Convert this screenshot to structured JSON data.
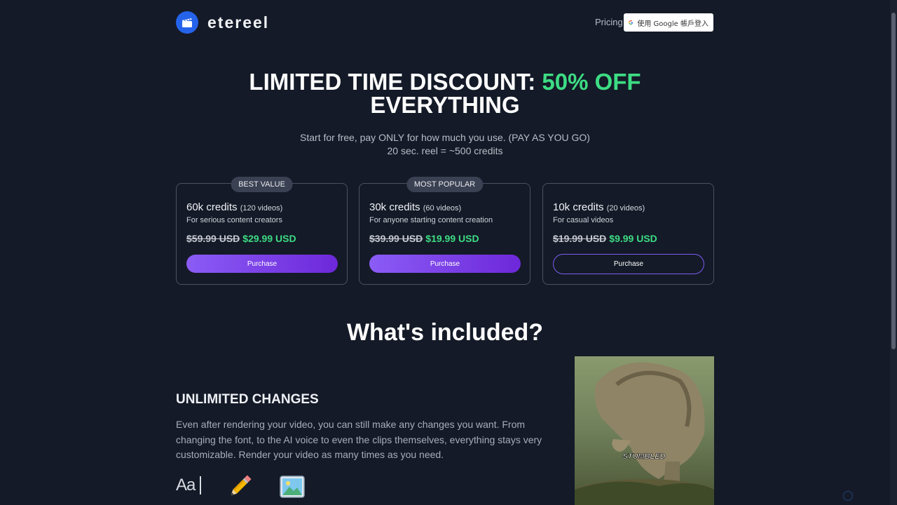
{
  "header": {
    "brand": "etereel",
    "nav_pricing": "Pricing",
    "google_signin": "使用 Google 帳戶登入"
  },
  "hero": {
    "title_part1": "LIMITED TIME DISCOUNT: ",
    "title_accent": "50% OFF",
    "title_part2": "EVERYTHING",
    "subtitle_line1": "Start for free, pay ONLY for how much you use. (PAY AS YOU GO)",
    "subtitle_line2": "20 sec. reel = ~500 credits"
  },
  "plans": [
    {
      "badge": "BEST VALUE",
      "credits": "60k credits",
      "videos": "(120 videos)",
      "desc": "For serious content creators",
      "old_price": "$59.99 USD",
      "new_price": "$29.99 USD",
      "button": "Purchase"
    },
    {
      "badge": "MOST POPULAR",
      "credits": "30k credits",
      "videos": "(60 videos)",
      "desc": "For anyone starting content creation",
      "old_price": "$39.99 USD",
      "new_price": "$19.99 USD",
      "button": "Purchase"
    },
    {
      "badge": "",
      "credits": "10k credits",
      "videos": "(20 videos)",
      "desc": "For casual videos",
      "old_price": "$19.99 USD",
      "new_price": "$9.99 USD",
      "button": "Purchase"
    }
  ],
  "included": {
    "section_title": "What's included?",
    "feature_title": "UNLIMITED CHANGES",
    "feature_text": "Even after rendering your video, you can still make any changes you want. From changing the font, to the AI voice to even the clips themselves, everything stays very customizable. Render your video as many times as you need.",
    "icon_font_label": "Aa",
    "preview_caption": "STUMBLED"
  },
  "colors": {
    "background": "#141a27",
    "accent_green": "#3ddc84",
    "purple": "#7c5cf0",
    "logo_blue": "#2563eb"
  },
  "icons": [
    "clapperboard-icon",
    "google-icon",
    "font-icon",
    "pencil-icon",
    "image-icon"
  ]
}
